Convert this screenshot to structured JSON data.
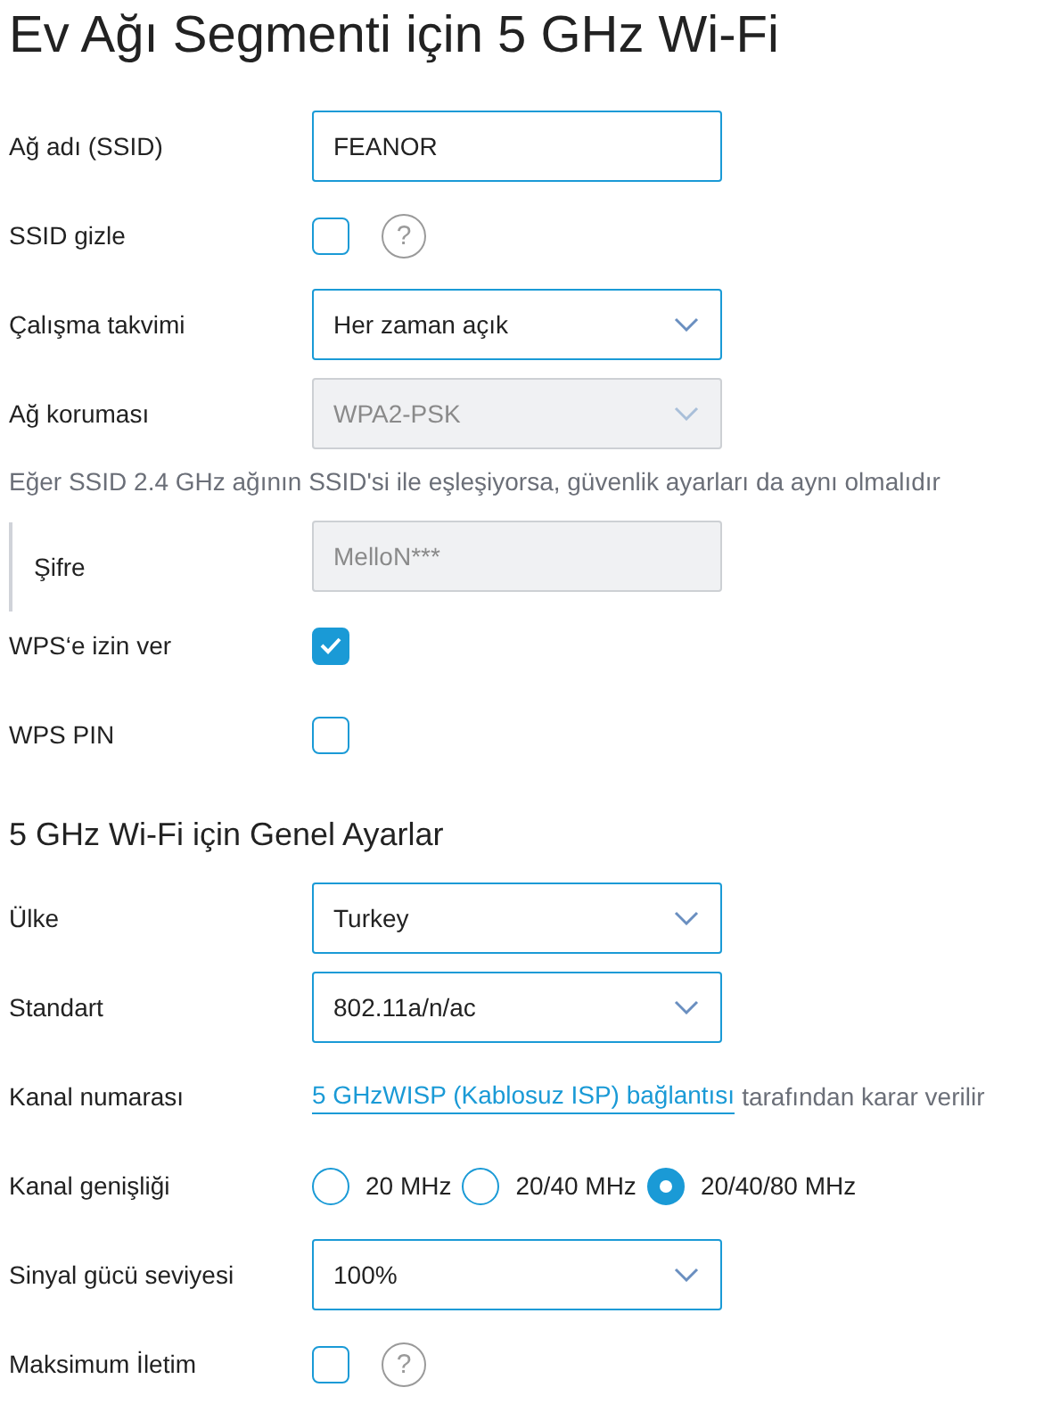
{
  "title": "Ev Ağı Segmenti için 5 GHz Wi-Fi",
  "rows": [
    {
      "kind": "text",
      "label": "Ağ adı (SSID)",
      "value": "FEANOR",
      "disabled": false
    },
    {
      "kind": "checkbox",
      "label": "SSID gizle",
      "checked": false,
      "help": "?"
    },
    {
      "kind": "select",
      "label": "Çalışma takvimi",
      "value": "Her zaman açık",
      "disabled": false
    },
    {
      "kind": "select",
      "label": "Ağ koruması",
      "value": "WPA2-PSK",
      "disabled": true
    },
    {
      "kind": "note",
      "text": "Eğer SSID 2.4 GHz ağının SSID'si ile eşleşiyorsa, güvenlik ayarları da aynı olmalıdır"
    },
    {
      "kind": "password",
      "label": "Şifre",
      "value": "MelloN***",
      "disabled": true
    },
    {
      "kind": "checkbox",
      "label": "WPS‘e izin ver",
      "checked": true
    },
    {
      "kind": "checkbox",
      "label": "WPS PIN",
      "checked": false
    },
    {
      "kind": "heading",
      "text": "5 GHz Wi-Fi için Genel Ayarlar"
    },
    {
      "kind": "select",
      "label": "Ülke",
      "value": "Turkey",
      "disabled": false
    },
    {
      "kind": "select",
      "label": "Standart",
      "value": "802.11a/n/ac",
      "disabled": false
    },
    {
      "kind": "link",
      "label": "Kanal numarası",
      "link": "5 GHzWISP (Kablosuz ISP) bağlantısı",
      "text": "tarafından karar verilir"
    },
    {
      "kind": "radio",
      "label": "Kanal genişliği",
      "options": [
        {
          "label": "20 MHz",
          "selected": false
        },
        {
          "label": "20/40 MHz",
          "selected": false
        },
        {
          "label": "20/40/80 MHz",
          "selected": true
        }
      ]
    },
    {
      "kind": "select",
      "label": "Sinyal gücü seviyesi",
      "value": "100%",
      "disabled": false
    },
    {
      "kind": "checkbox",
      "label": "Maksimum İletim",
      "checked": false,
      "help": "?"
    }
  ]
}
